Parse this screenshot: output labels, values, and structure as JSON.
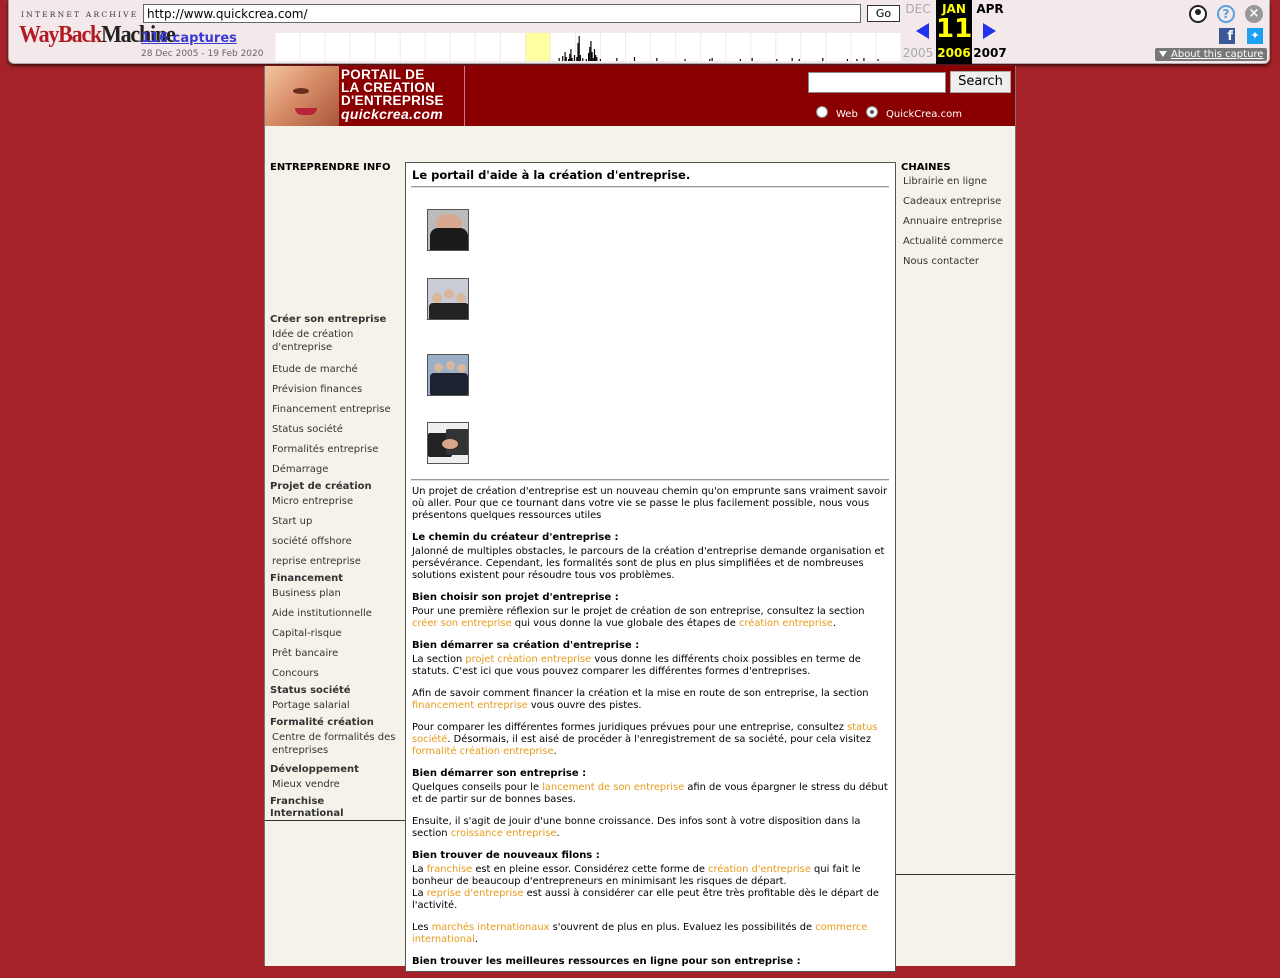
{
  "wayback": {
    "logo_top": "INTERNET ARCHIVE",
    "logo_way": "WayBack",
    "logo_machine": "Machine",
    "url": "http://www.quickcrea.com/",
    "go_label": "Go",
    "captures_label": "116 captures",
    "date_range": "28 Dec 2005 - 19 Feb 2020",
    "prev_month": "DEC",
    "prev_year": "2005",
    "cur_month": "JAN",
    "cur_day": "11",
    "cur_year": "2006",
    "next_month": "APR",
    "next_year": "2007",
    "about_label": "About this capture",
    "sparkline": [
      0,
      0,
      0,
      0,
      0,
      0,
      0,
      0,
      0,
      0,
      0,
      0,
      0,
      0,
      0,
      0,
      0,
      0,
      0,
      0,
      0,
      0,
      0,
      0,
      0,
      0,
      0,
      0,
      0,
      0,
      0,
      0,
      0,
      0,
      0,
      0,
      0,
      0,
      0,
      0,
      0,
      0,
      0,
      0,
      0,
      0,
      0,
      0,
      0,
      0,
      0,
      0,
      0,
      0,
      0,
      0,
      0,
      0,
      0,
      0,
      0,
      0,
      0,
      0,
      0,
      0,
      0,
      0,
      0,
      0,
      0,
      0,
      0,
      0,
      0,
      0,
      0,
      0,
      0,
      0,
      0,
      0,
      0,
      0,
      0,
      0,
      0,
      0,
      0,
      0,
      0,
      0,
      0,
      0,
      0,
      0,
      0,
      0,
      0,
      0,
      0,
      0,
      0,
      0,
      0,
      0,
      0,
      0,
      0,
      0,
      0,
      0,
      0,
      0,
      0,
      0,
      0,
      0,
      0,
      0,
      0,
      0,
      0,
      0,
      0,
      0,
      0,
      0,
      0,
      0,
      0,
      0,
      0,
      0,
      0,
      0,
      0,
      0,
      0,
      0,
      0,
      0,
      0,
      0,
      0,
      0,
      0,
      0,
      0,
      0,
      0,
      0,
      0,
      0,
      0,
      0,
      0,
      0,
      0,
      0,
      0,
      0,
      0,
      0,
      0,
      0,
      0,
      0,
      0,
      0,
      0,
      0,
      0,
      0,
      0,
      0,
      0,
      0,
      0,
      0,
      0,
      0,
      0,
      0,
      0,
      0,
      0,
      0,
      0,
      0,
      0,
      0,
      0,
      0,
      0,
      0,
      0,
      0,
      0,
      0,
      0,
      0,
      0,
      0,
      0,
      0,
      0,
      0,
      0,
      0,
      0,
      0,
      0,
      0,
      0,
      0,
      0,
      0,
      0,
      0,
      0,
      0,
      0,
      0,
      0,
      0,
      0,
      0,
      0,
      0,
      0,
      0,
      0,
      0,
      0,
      0,
      0,
      0,
      0,
      0,
      0,
      3,
      0,
      0,
      5,
      0,
      9,
      4,
      0,
      2,
      7,
      12,
      3,
      0,
      6,
      0,
      4,
      18,
      25,
      6,
      0,
      3,
      0,
      0,
      2,
      0,
      8,
      14,
      20,
      9,
      3,
      12,
      6,
      4,
      0,
      0,
      2,
      0,
      0,
      0,
      0,
      0,
      0,
      0,
      0,
      0,
      0,
      0,
      0,
      0,
      3,
      0,
      0,
      0,
      0,
      0,
      0,
      0,
      0,
      0,
      0,
      0,
      0,
      0,
      0,
      4,
      0,
      0,
      0,
      0,
      0,
      0,
      0,
      0,
      0,
      0,
      0,
      0,
      0,
      0,
      0,
      0,
      0,
      0,
      3,
      0,
      0,
      0,
      0,
      0,
      0,
      0,
      0,
      0,
      0,
      0,
      0,
      0,
      0,
      0,
      0,
      0,
      0,
      0,
      0,
      0,
      0,
      0,
      2,
      0,
      0,
      0,
      0,
      0,
      0,
      0,
      0,
      0,
      0,
      0,
      0,
      0,
      0,
      0,
      0,
      0,
      0,
      0,
      0,
      2,
      0,
      3,
      0,
      0,
      0,
      0,
      0,
      0,
      0,
      0,
      0,
      0,
      0,
      0,
      0,
      0,
      0,
      0,
      0,
      0,
      0,
      0,
      0,
      0,
      0,
      2,
      0,
      0,
      0,
      0,
      0,
      0,
      0,
      0,
      0,
      3,
      0,
      0,
      0,
      0,
      0,
      0,
      0,
      0,
      0,
      0,
      0,
      0,
      0,
      0,
      0,
      0,
      0,
      0,
      0,
      0,
      2,
      0,
      0,
      0,
      0,
      0,
      0,
      0,
      0,
      0,
      0,
      0,
      0,
      3,
      0,
      0,
      0,
      0,
      0,
      2,
      0,
      0,
      0,
      0,
      0,
      0,
      0,
      0,
      0,
      0,
      0,
      0,
      0,
      0,
      0,
      0,
      0,
      0,
      0,
      3,
      0,
      0,
      0,
      0,
      0,
      0,
      0,
      0,
      0,
      0,
      0,
      0,
      0,
      0,
      0,
      0,
      0,
      0,
      0,
      0,
      2,
      0,
      0,
      0,
      0,
      0,
      0,
      0,
      2,
      0,
      0,
      0,
      0,
      0,
      3,
      0,
      0,
      0,
      0,
      0,
      0,
      0,
      0,
      0,
      0,
      0,
      2,
      0,
      0,
      0,
      0,
      0,
      0,
      0,
      0,
      0,
      0,
      0,
      0,
      0,
      0,
      0,
      0,
      0,
      0,
      0
    ]
  },
  "site": {
    "logo": {
      "line1": "PORTAIL DE",
      "line2": "LA CREATION",
      "line3": "D'ENTREPRISE",
      "line4": "quickcrea.com"
    },
    "search_button": "Search",
    "radio_web": "Web",
    "radio_site": "QuickCrea.com",
    "left_header": "ENTREPRENDRE INFO",
    "left_sections": [
      {
        "title": "Créer son entreprise",
        "links": [
          "Idée de création d'entreprise",
          "Etude de marché",
          "Prévision finances",
          "Financement entreprise",
          "Status société",
          "Formalités entreprise",
          "Démarrage"
        ]
      },
      {
        "title": "Projet de création",
        "links": [
          "Micro entreprise",
          "Start up",
          "société offshore",
          "reprise entreprise"
        ]
      },
      {
        "title": "Financement",
        "links": [
          "Business plan",
          "Aide institutionnelle",
          "Capital-risque",
          "Prêt bancaire",
          "Concours"
        ]
      },
      {
        "title": "Status société",
        "links": [
          "Portage salarial"
        ]
      },
      {
        "title": "Formalité création",
        "links": [
          "Centre de formalités des entreprises"
        ]
      },
      {
        "title": "Développement",
        "links": [
          "Mieux vendre"
        ]
      },
      {
        "title": "Franchise International",
        "links": []
      }
    ],
    "main_title": "Le portail d'aide à la création d'entreprise.",
    "intro": "Un projet de création d'entreprise est un nouveau chemin qu'on emprunte sans vraiment savoir où aller. Pour que ce tournant dans votre vie se passe le plus facilement possible, nous vous présentons quelques ressources utiles",
    "h_chemin": "Le chemin du créateur d'entreprise :",
    "p_chemin": "Jalonné de multiples obstacles, le parcours de la création d'entreprise demande organisation et persévérance. Cependant, les formalités sont de plus en plus simplifiées et de nombreuses solutions existent pour résoudre tous vos problèmes.",
    "h_choisir": "Bien choisir son projet d'entreprise :",
    "p_choisir_a": "Pour une première réflexion sur le projet de création de son entreprise, consultez la section ",
    "l_creer": "créer son entreprise",
    "p_choisir_b": " qui vous donne la vue globale des étapes de ",
    "l_creation": "création entreprise",
    "p_choisir_c": ".",
    "h_demarrer1": "Bien démarrer sa création d'entreprise :",
    "p_dem1_a": "La section ",
    "l_projet": "projet création entreprise",
    "p_dem1_b": " vous donne les différents choix possibles en terme de statuts. C'est ici que vous pouvez comparer les différentes formes d'entreprises.",
    "p_fin_a": "Afin de savoir comment financer la création et la mise en route de son entreprise, la section ",
    "l_financement": "financement entreprise",
    "p_fin_b": " vous ouvre des pistes.",
    "p_comp_a": "Pour comparer les différentes formes juridiques prévues pour une entreprise, consultez ",
    "l_status": "status société",
    "p_comp_b": ". Désormais, il est aisé de procéder à l'enregistrement de sa société, pour cela visitez ",
    "l_formalite": "formalité création entreprise",
    "p_comp_c": ".",
    "h_demarrer2": "Bien démarrer son entreprise :",
    "p_dem2_a": "Quelques conseils pour le ",
    "l_lancement": "lancement de son entreprise",
    "p_dem2_b": " afin de vous épargner le stress du début et de partir sur de bonnes bases.",
    "p_crois_a": "Ensuite, il s'agit de jouir d'une bonne croissance. Des infos sont à votre disposition dans la section ",
    "l_croissance": "croissance entreprise",
    "p_crois_b": ".",
    "h_filons": "Bien trouver de nouveaux filons :",
    "p_fil_a": "La ",
    "l_franchise": "franchise",
    "p_fil_b": " est en pleine essor. Considérez cette forme de ",
    "l_creation2": "création d'entreprise",
    "p_fil_c": " qui fait le bonheur de beaucoup d'entrepreneurs en minimisant les risques de départ.",
    "p_fil_d": "La ",
    "l_reprise": "reprise d'entreprise",
    "p_fil_e": " est aussi à considérer car elle peut être très profitable dès le départ de l'activité.",
    "p_mar_a": "Les ",
    "l_marches": "marchés internationaux",
    "p_mar_b": " s'ouvrent de plus en plus. Evaluez les possibilités de ",
    "l_commerce": "commerce international",
    "p_mar_c": ".",
    "h_ressources": "Bien trouver les meilleures ressources en ligne pour son entreprise :",
    "right_header": "CHAINES",
    "right_links": [
      "Librairie en ligne",
      "Cadeaux entreprise",
      "Annuaire entreprise",
      "Actualité commerce",
      "Nous contacter"
    ]
  }
}
